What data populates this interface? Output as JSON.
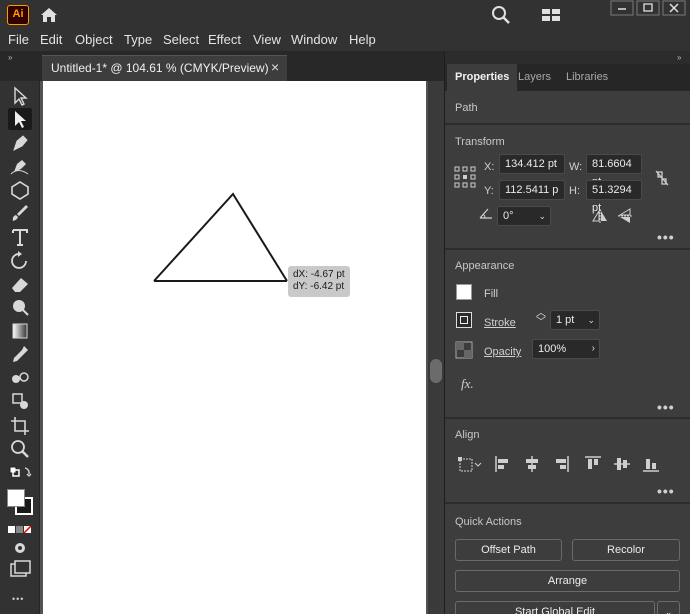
{
  "app": {
    "logo_text": "Ai"
  },
  "menu": [
    "File",
    "Edit",
    "Object",
    "Type",
    "Select",
    "Effect",
    "View",
    "Window",
    "Help"
  ],
  "document_tab": {
    "title": "Untitled-1* @ 104.61 % (CMYK/Preview)",
    "close": "×"
  },
  "tooltip": {
    "dx": "dX: -4.67 pt",
    "dy": "dY: -6.42 pt"
  },
  "panel": {
    "collapse": "»",
    "tabs": [
      "Properties",
      "Layers",
      "Libraries"
    ],
    "object_type": "Path",
    "transform": {
      "title": "Transform",
      "x_label": "X:",
      "x_value": "134.412 pt",
      "y_label": "Y:",
      "y_value": "112.5411 p",
      "w_label": "W:",
      "w_value": "81.6604 pt",
      "h_label": "H:",
      "h_value": "51.3294 pt",
      "angle_value": "0°"
    },
    "appearance": {
      "title": "Appearance",
      "fill_label": "Fill",
      "stroke_label": "Stroke",
      "stroke_value": "1 pt",
      "opacity_label": "Opacity",
      "opacity_value": "100%",
      "fx_label": "fx."
    },
    "align": {
      "title": "Align"
    },
    "quick_actions": {
      "title": "Quick Actions",
      "offset_path": "Offset Path",
      "recolor": "Recolor",
      "arrange": "Arrange",
      "start_global_edit": "Start Global Edit"
    },
    "more": "•••"
  },
  "toolbar": {
    "collapse": "»",
    "more": "•••"
  },
  "colors": {
    "accent": "#ff9a00",
    "logo_bg": "#330000",
    "panel_bg": "#3d3d3d",
    "canvas_bg": "#535353"
  }
}
